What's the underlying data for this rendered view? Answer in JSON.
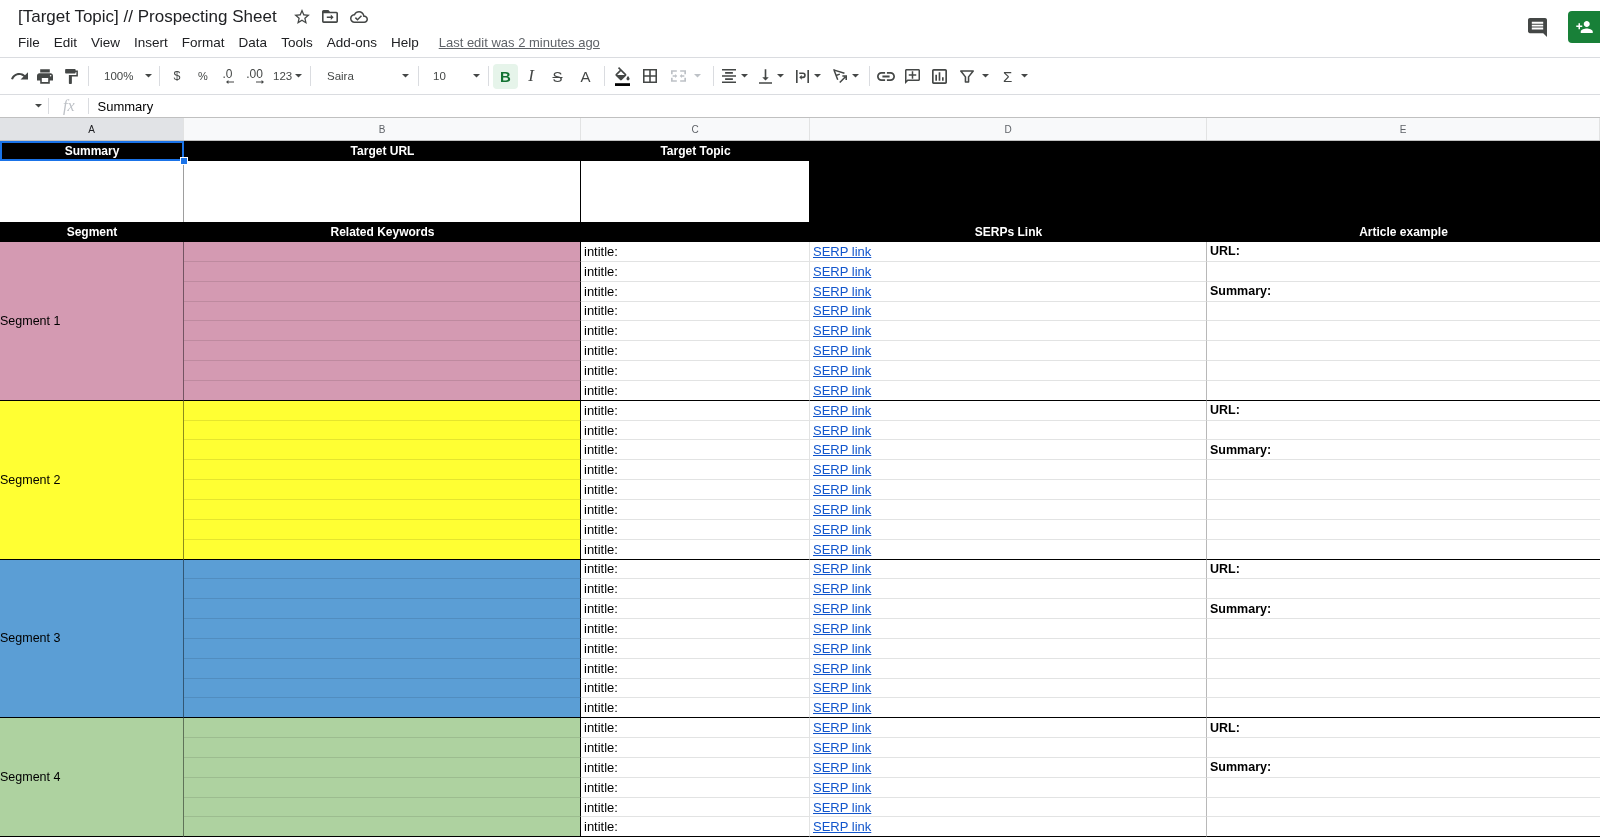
{
  "document": {
    "title": "[Target Topic] // Prospecting Sheet"
  },
  "menu": [
    "File",
    "Edit",
    "View",
    "Insert",
    "Format",
    "Data",
    "Tools",
    "Add-ons",
    "Help"
  ],
  "last_edit": "Last edit was 2 minutes ago",
  "toolbar": {
    "zoom": "100%",
    "currency": "$",
    "percent": "%",
    "decrease_decimals": ".0",
    "increase_decimals": ".00",
    "more_formats": "123",
    "font": "Saira",
    "font_size": "10",
    "bold": {
      "label": "B",
      "on": true
    },
    "italic": {
      "label": "I",
      "on": false
    },
    "strikethrough": {
      "label": "S",
      "on": false
    },
    "text_color": "A",
    "merge": {
      "disabled": true
    },
    "functions": "Σ"
  },
  "formula_bar": {
    "fx": "fx",
    "value": "Summary"
  },
  "columns": [
    {
      "label": "A",
      "selected": true
    },
    {
      "label": "B",
      "selected": false
    },
    {
      "label": "C",
      "selected": false
    },
    {
      "label": "D",
      "selected": false
    },
    {
      "label": "E",
      "selected": false
    }
  ],
  "top_headers": [
    {
      "text": "Summary",
      "selected": true
    },
    {
      "text": "Target URL",
      "selected": false
    },
    {
      "text": "Target Topic",
      "selected": false
    }
  ],
  "section_headers": {
    "segment": "Segment",
    "keywords": "Related Keywords",
    "serps": "SERPs Link",
    "article": "Article example"
  },
  "segments": [
    {
      "name": "Segment 1",
      "color": "#d49ab2",
      "rows": [
        {
          "query": "intitle:",
          "link": "SERP link",
          "article": "URL:"
        },
        {
          "query": "intitle:",
          "link": "SERP link"
        },
        {
          "query": "intitle:",
          "link": "SERP link",
          "article": "Summary:"
        },
        {
          "query": "intitle:",
          "link": "SERP link"
        },
        {
          "query": "intitle:",
          "link": "SERP link"
        },
        {
          "query": "intitle:",
          "link": "SERP link"
        },
        {
          "query": "intitle:",
          "link": "SERP link"
        },
        {
          "query": "intitle:",
          "link": "SERP link"
        }
      ]
    },
    {
      "name": "Segment 2",
      "color": "#ffff33",
      "rows": [
        {
          "query": "intitle:",
          "link": "SERP link",
          "article": "URL:"
        },
        {
          "query": "intitle:",
          "link": "SERP link"
        },
        {
          "query": "intitle:",
          "link": "SERP link",
          "article": "Summary:"
        },
        {
          "query": "intitle:",
          "link": "SERP link"
        },
        {
          "query": "intitle:",
          "link": "SERP link"
        },
        {
          "query": "intitle:",
          "link": "SERP link"
        },
        {
          "query": "intitle:",
          "link": "SERP link"
        },
        {
          "query": "intitle:",
          "link": "SERP link"
        }
      ]
    },
    {
      "name": "Segment 3",
      "color": "#5b9ed5",
      "rows": [
        {
          "query": "intitle:",
          "link": "SERP link",
          "article": "URL:"
        },
        {
          "query": "intitle:",
          "link": "SERP link"
        },
        {
          "query": "intitle:",
          "link": "SERP link",
          "article": "Summary:"
        },
        {
          "query": "intitle:",
          "link": "SERP link"
        },
        {
          "query": "intitle:",
          "link": "SERP link"
        },
        {
          "query": "intitle:",
          "link": "SERP link"
        },
        {
          "query": "intitle:",
          "link": "SERP link"
        },
        {
          "query": "intitle:",
          "link": "SERP link"
        }
      ]
    },
    {
      "name": "Segment 4",
      "color": "#aed2a0",
      "rows": [
        {
          "query": "intitle:",
          "link": "SERP link",
          "article": "URL:"
        },
        {
          "query": "intitle:",
          "link": "SERP link"
        },
        {
          "query": "intitle:",
          "link": "SERP link",
          "article": "Summary:"
        },
        {
          "query": "intitle:",
          "link": "SERP link"
        },
        {
          "query": "intitle:",
          "link": "SERP link"
        },
        {
          "query": "intitle:",
          "link": "SERP link"
        }
      ]
    }
  ]
}
